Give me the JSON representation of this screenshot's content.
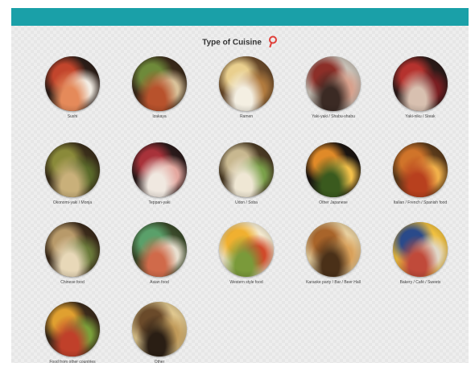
{
  "page": {
    "title": "Type of Cuisine",
    "accent": "#1aa0a8",
    "pin_color": "#e0403a",
    "pin_icon": "map-pin-icon"
  },
  "categories": [
    {
      "label": "Sushi",
      "palette": [
        "#c2452c",
        "#f2ede4",
        "#e58a5a",
        "#2c1e18"
      ]
    },
    {
      "label": "Izakaya",
      "palette": [
        "#6e8a3a",
        "#d9c29a",
        "#b8522c",
        "#3a2a1a"
      ]
    },
    {
      "label": "Ramen",
      "palette": [
        "#e9cf8e",
        "#b07a3e",
        "#f4efe2",
        "#6a4a2a"
      ]
    },
    {
      "label": "Yaki-yaki / Shabu-shabu",
      "palette": [
        "#8c2f28",
        "#d7a08c",
        "#3b2a24",
        "#c9c2b8"
      ]
    },
    {
      "label": "Yaki-niku / Steak",
      "palette": [
        "#b5322e",
        "#7a1e22",
        "#d8c0b0",
        "#2a1a18"
      ]
    },
    {
      "label": "Okonomi-yaki / Monja",
      "palette": [
        "#8a8a3a",
        "#5a6a2a",
        "#c9b07a",
        "#3a2e1a"
      ]
    },
    {
      "label": "Teppan-yaki",
      "palette": [
        "#a8323a",
        "#e4a8a0",
        "#f0e8e0",
        "#2a1a1a"
      ]
    },
    {
      "label": "Udon / Soba",
      "palette": [
        "#c8b890",
        "#7aa04a",
        "#efe7d4",
        "#4a3a24"
      ]
    },
    {
      "label": "Other Japanese",
      "palette": [
        "#e08a28",
        "#f2c04a",
        "#3a5a1e",
        "#1a1410"
      ]
    },
    {
      "label": "Italian / French / Spanish food",
      "palette": [
        "#d0742a",
        "#f0b04a",
        "#b8401e",
        "#5a3a1a"
      ]
    },
    {
      "label": "Chinese food",
      "palette": [
        "#b89a6a",
        "#6a7a3a",
        "#e8d8b8",
        "#3a2a1a"
      ]
    },
    {
      "label": "Asian food",
      "palette": [
        "#5aa06a",
        "#e8e0d0",
        "#d06a4a",
        "#3a4a2a"
      ]
    },
    {
      "label": "Western style food",
      "palette": [
        "#f0b030",
        "#d04a2a",
        "#7a9a3a",
        "#f4ead0"
      ]
    },
    {
      "label": "Karaoke party / Bar / Beer Hall",
      "palette": [
        "#a8642a",
        "#d8a05a",
        "#4a3018",
        "#e8d0a0"
      ]
    },
    {
      "label": "Bakery / Café / Sweets",
      "palette": [
        "#2a4a8a",
        "#e0d8c8",
        "#c04a3a",
        "#f0c040"
      ]
    },
    {
      "label": "Food from other countries",
      "palette": [
        "#e0a030",
        "#7aa03a",
        "#c0402a",
        "#3a2a1a"
      ]
    },
    {
      "label": "Other",
      "palette": [
        "#6a4a2a",
        "#c09a5a",
        "#2a1e14",
        "#e0c890"
      ]
    }
  ]
}
